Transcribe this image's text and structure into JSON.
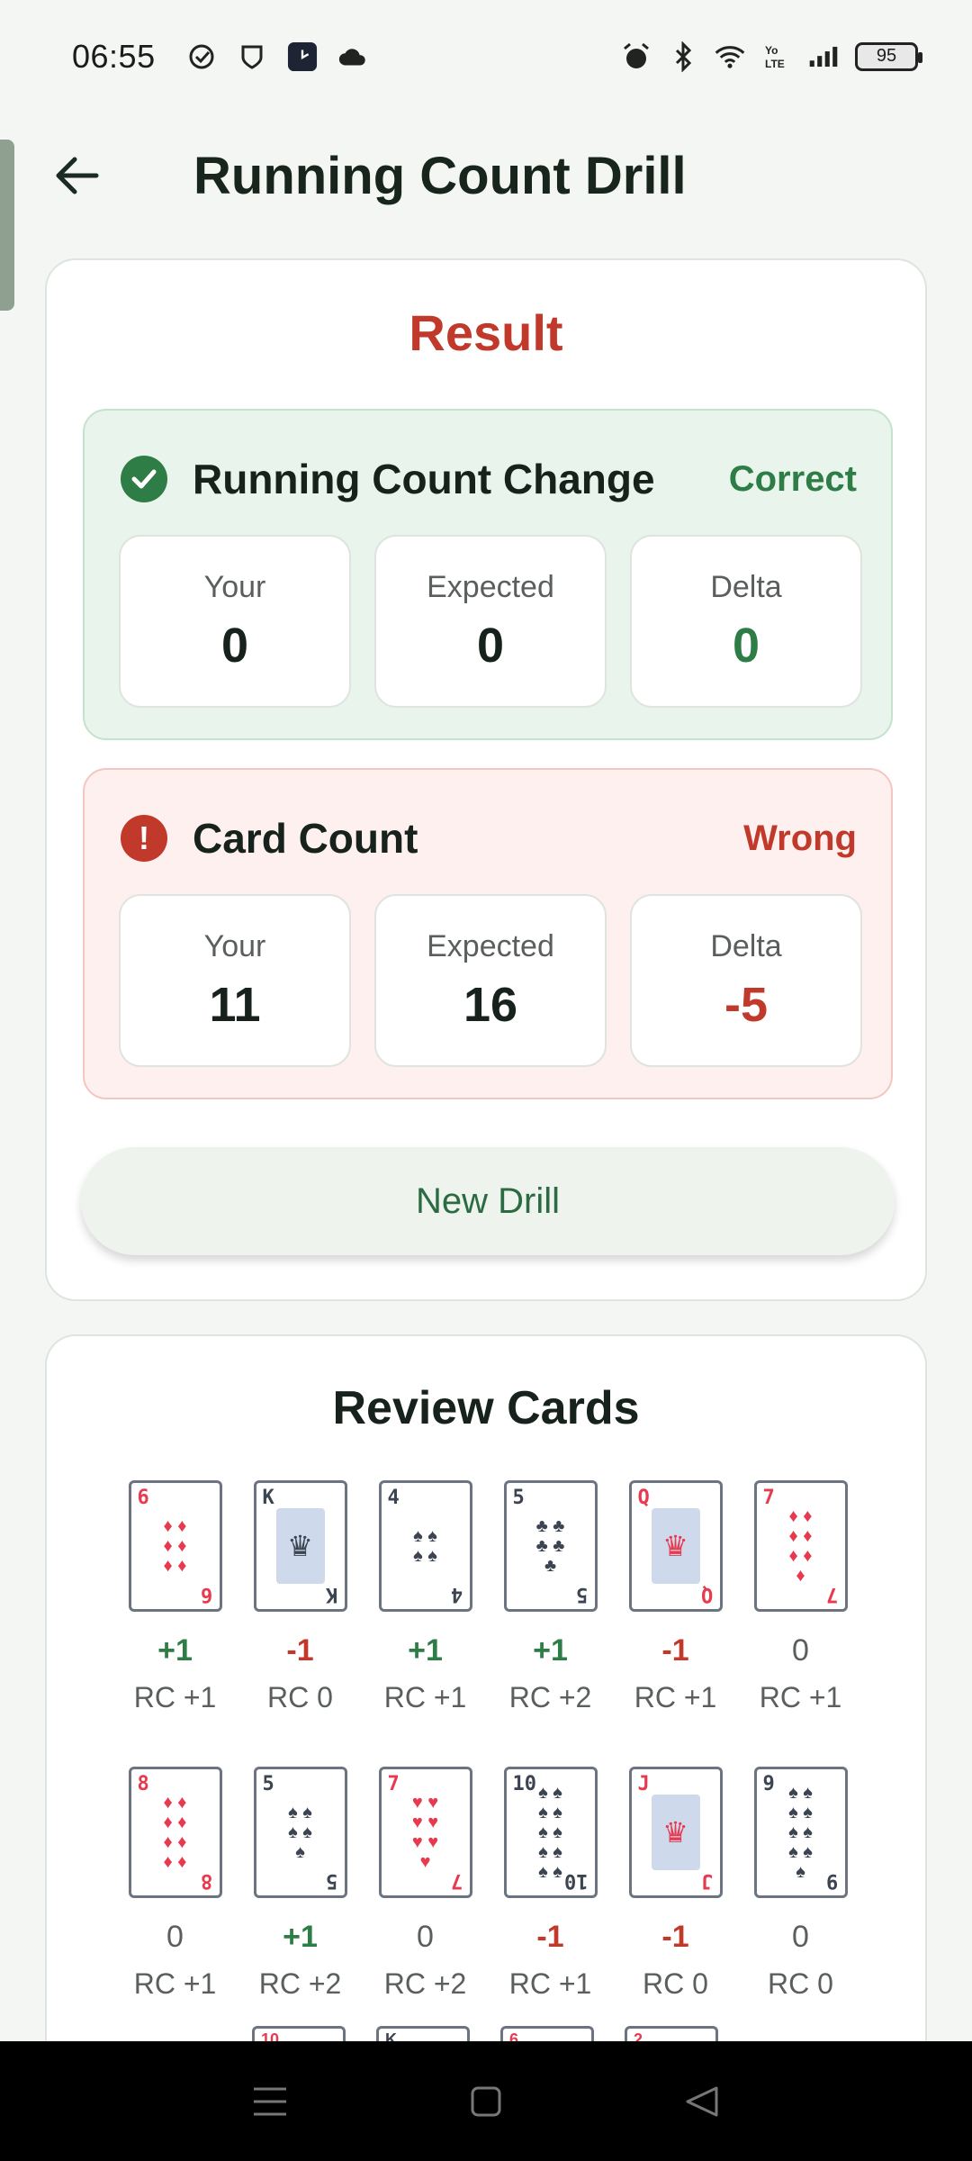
{
  "status_bar": {
    "time": "06:55",
    "battery": "95"
  },
  "app_bar": {
    "title": "Running Count Drill"
  },
  "result": {
    "title": "Result",
    "running_count": {
      "title": "Running Count Change",
      "verdict": "Correct",
      "your_label": "Your",
      "your_value": "0",
      "expected_label": "Expected",
      "expected_value": "0",
      "delta_label": "Delta",
      "delta_value": "0"
    },
    "card_count": {
      "title": "Card Count",
      "verdict": "Wrong",
      "your_label": "Your",
      "your_value": "11",
      "expected_label": "Expected",
      "expected_value": "16",
      "delta_label": "Delta",
      "delta_value": "-5"
    },
    "new_drill_label": "New Drill"
  },
  "review": {
    "title": "Review Cards",
    "rows": [
      [
        {
          "rank": "6",
          "suit": "♦",
          "color": "red",
          "delta": "+1",
          "rc": "RC +1"
        },
        {
          "rank": "K",
          "suit": "♦",
          "color": "blue",
          "delta": "-1",
          "rc": "RC 0"
        },
        {
          "rank": "4",
          "suit": "♠",
          "color": "black",
          "delta": "+1",
          "rc": "RC +1"
        },
        {
          "rank": "5",
          "suit": "♣",
          "color": "black",
          "delta": "+1",
          "rc": "RC +2"
        },
        {
          "rank": "Q",
          "suit": "♥",
          "color": "red",
          "delta": "-1",
          "rc": "RC +1"
        },
        {
          "rank": "7",
          "suit": "♦",
          "color": "red",
          "delta": "0",
          "rc": "RC +1"
        }
      ],
      [
        {
          "rank": "8",
          "suit": "♦",
          "color": "red",
          "delta": "0",
          "rc": "RC +1"
        },
        {
          "rank": "5",
          "suit": "♠",
          "color": "black",
          "delta": "+1",
          "rc": "RC +2"
        },
        {
          "rank": "7",
          "suit": "♥",
          "color": "red",
          "delta": "0",
          "rc": "RC +2"
        },
        {
          "rank": "10",
          "suit": "♠",
          "color": "black",
          "delta": "-1",
          "rc": "RC +1"
        },
        {
          "rank": "J",
          "suit": "♦",
          "color": "red",
          "delta": "-1",
          "rc": "RC 0"
        },
        {
          "rank": "9",
          "suit": "♠",
          "color": "black",
          "delta": "0",
          "rc": "RC 0"
        }
      ]
    ]
  },
  "colors": {
    "accent_green": "#2e7d46",
    "accent_red": "#c0392b",
    "background": "#f3f6f3"
  }
}
